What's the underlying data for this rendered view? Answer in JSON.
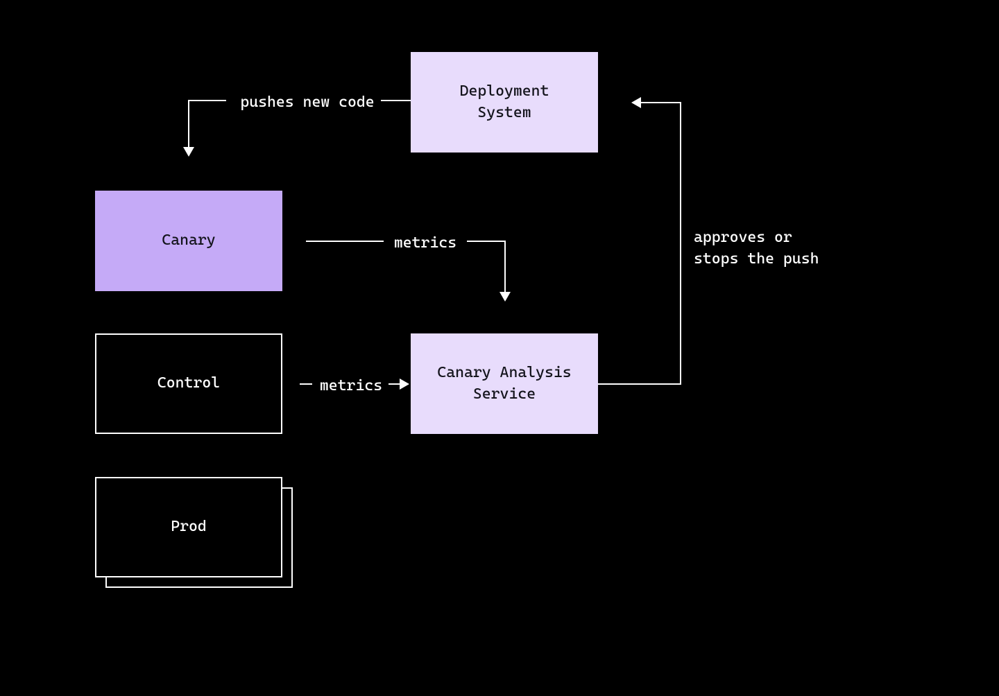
{
  "nodes": {
    "deployment_system": "Deployment\nSystem",
    "canary": "Canary",
    "control": "Control",
    "prod": "Prod",
    "canary_analysis_service": "Canary Analysis\nService"
  },
  "edges": {
    "pushes_new_code": "pushes new code",
    "metrics_canary": "metrics",
    "metrics_control": "metrics",
    "approves_stops": "approves or\nstops the push"
  },
  "colors": {
    "bg": "#000000",
    "light_fill": "#e8dcfc",
    "mid_fill": "#c5aaf7",
    "text_dark": "#14141c",
    "line": "#ffffff"
  }
}
